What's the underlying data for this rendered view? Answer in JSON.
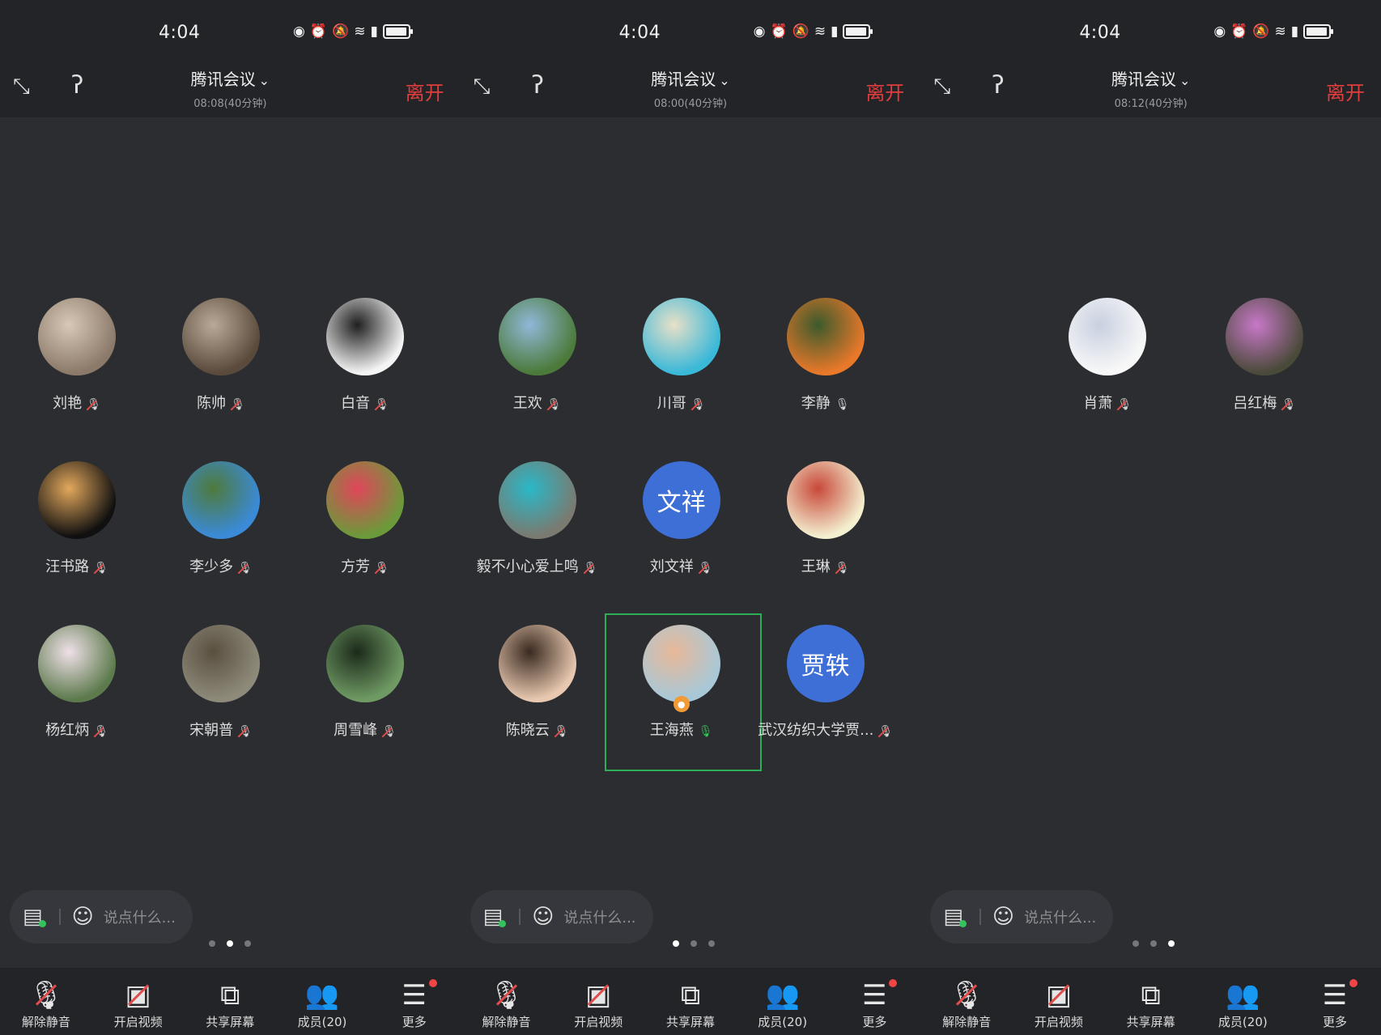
{
  "screens": [
    {
      "status": {
        "time": "4:04",
        "icons": [
          "eye-icon",
          "alarm-icon",
          "mute-icon",
          "wifi-icon",
          "signal-icon",
          "battery-icon"
        ]
      },
      "header": {
        "meeting_title": "腾讯会议",
        "duration": "08:08(40分钟)",
        "leave_label": "离开"
      },
      "participants": [
        {
          "name": "刘艳",
          "mic": "muted",
          "avatar": "photo",
          "colors": [
            "#8b7a6a",
            "#d8c8b8"
          ]
        },
        {
          "name": "陈帅",
          "mic": "muted",
          "avatar": "photo",
          "colors": [
            "#5a4a3c",
            "#b9aa98"
          ]
        },
        {
          "name": "白音",
          "mic": "muted",
          "avatar": "photo",
          "colors": [
            "#f4f4f4",
            "#1f1f1f"
          ]
        },
        {
          "name": "汪书路",
          "mic": "muted",
          "avatar": "photo",
          "colors": [
            "#101010",
            "#e3a85c"
          ]
        },
        {
          "name": "李少多",
          "mic": "muted",
          "avatar": "photo",
          "colors": [
            "#3a8ad8",
            "#4f7a3c"
          ]
        },
        {
          "name": "方芳",
          "mic": "muted",
          "avatar": "photo",
          "colors": [
            "#6b9a3a",
            "#e0465a"
          ]
        },
        {
          "name": "杨红炳",
          "mic": "muted",
          "avatar": "photo",
          "colors": [
            "#5c7a4c",
            "#f0e0e8"
          ]
        },
        {
          "name": "宋朝普",
          "mic": "muted",
          "avatar": "photo",
          "colors": [
            "#8e8a7a",
            "#5a5040"
          ]
        },
        {
          "name": "周雪峰",
          "mic": "muted",
          "avatar": "photo",
          "colors": [
            "#6f9a64",
            "#1c2a1a"
          ]
        }
      ],
      "chat": {
        "placeholder": "说点什么..."
      },
      "page_index": 1
    },
    {
      "status": {
        "time": "4:04",
        "icons": [
          "eye-icon",
          "alarm-icon",
          "mute-icon",
          "wifi-icon",
          "signal-icon",
          "battery-icon"
        ]
      },
      "header": {
        "meeting_title": "腾讯会议",
        "duration": "08:00(40分钟)",
        "leave_label": "离开"
      },
      "participants": [
        {
          "name": "王欢",
          "mic": "muted",
          "avatar": "photo",
          "colors": [
            "#4c7a3a",
            "#8fb8d8"
          ]
        },
        {
          "name": "川哥",
          "mic": "muted",
          "avatar": "photo",
          "colors": [
            "#3ab8d8",
            "#e8e0c8"
          ]
        },
        {
          "name": "李静",
          "mic": "on",
          "avatar": "photo",
          "colors": [
            "#e8782a",
            "#3c5a2c"
          ]
        },
        {
          "name": "毅不小心爱上鸣",
          "mic": "muted",
          "avatar": "photo",
          "colors": [
            "#7a7a70",
            "#2ab8c8"
          ]
        },
        {
          "name": "刘文祥",
          "mic": "muted",
          "avatar": "text",
          "avatar_text": "文祥",
          "colors": [
            "#3e6fd6",
            "#ffffff"
          ]
        },
        {
          "name": "王琳",
          "mic": "muted",
          "avatar": "photo",
          "colors": [
            "#f3efcf",
            "#c8483a"
          ]
        },
        {
          "name": "陈晓云",
          "mic": "muted",
          "avatar": "photo",
          "colors": [
            "#e8c8b0",
            "#3a2a20"
          ]
        },
        {
          "name": "王海燕",
          "mic": "active",
          "avatar": "photo",
          "colors": [
            "#a8c8d8",
            "#e8b898"
          ],
          "host": true,
          "speaking": true
        },
        {
          "name": "武汉纺织大学贾...",
          "mic": "muted",
          "avatar": "text",
          "avatar_text": "贾轶",
          "colors": [
            "#3e6fd6",
            "#ffffff"
          ]
        }
      ],
      "chat": {
        "placeholder": "说点什么..."
      },
      "page_index": 0
    },
    {
      "status": {
        "time": "4:04",
        "icons": [
          "eye-icon",
          "alarm-icon",
          "mute-icon",
          "wifi-icon",
          "signal-icon",
          "battery-icon"
        ]
      },
      "header": {
        "meeting_title": "腾讯会议",
        "duration": "08:12(40分钟)",
        "leave_label": "离开"
      },
      "participants": [
        {
          "name": "肖萧",
          "mic": "muted",
          "avatar": "photo",
          "colors": [
            "#f8f8f8",
            "#c8d0e0"
          ]
        },
        {
          "name": "吕红梅",
          "mic": "muted",
          "avatar": "photo",
          "colors": [
            "#4a4a3a",
            "#c878c8"
          ]
        }
      ],
      "chat": {
        "placeholder": "说点什么..."
      },
      "page_index": 2
    }
  ],
  "toolbar": {
    "unmute": "解除静音",
    "video": "开启视频",
    "share": "共享屏幕",
    "members": "成员(20)",
    "more": "更多"
  }
}
